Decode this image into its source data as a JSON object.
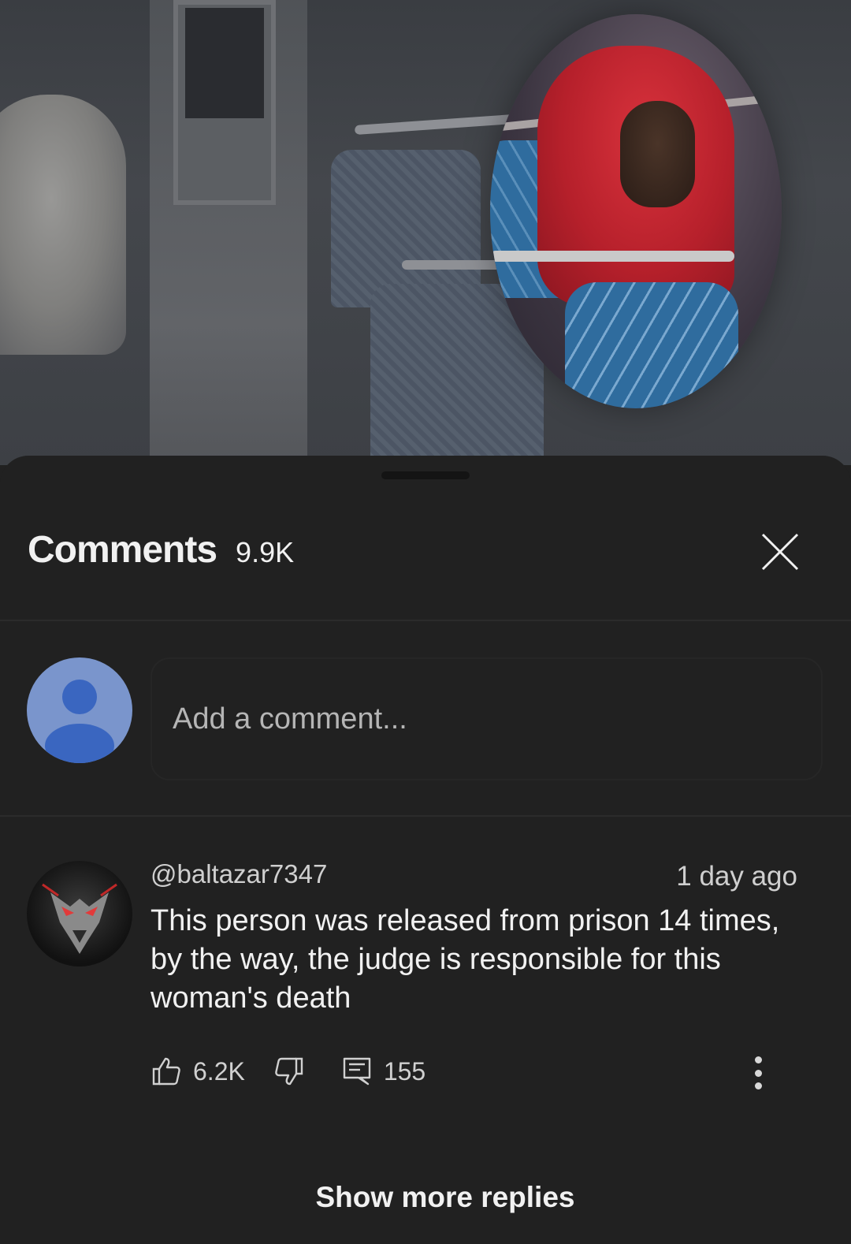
{
  "video": {
    "description_icon": "video-frame"
  },
  "comments": {
    "title": "Comments",
    "count": "9.9K",
    "close_icon": "close-icon"
  },
  "composer": {
    "placeholder": "Add a comment..."
  },
  "comment": {
    "username": "@baltazar7347",
    "time": "1 day ago",
    "text": "This person was released from prison 14 times, by the way, the judge is responsible for this woman's death",
    "likes": "6.2K",
    "replies": "155"
  },
  "footer": {
    "show_more": "Show more replies"
  },
  "colors": {
    "background": "#212121",
    "avatar_me": "#7a95cc",
    "avatar_me_figure": "#3a66c0",
    "text": "#f1f1f1"
  }
}
